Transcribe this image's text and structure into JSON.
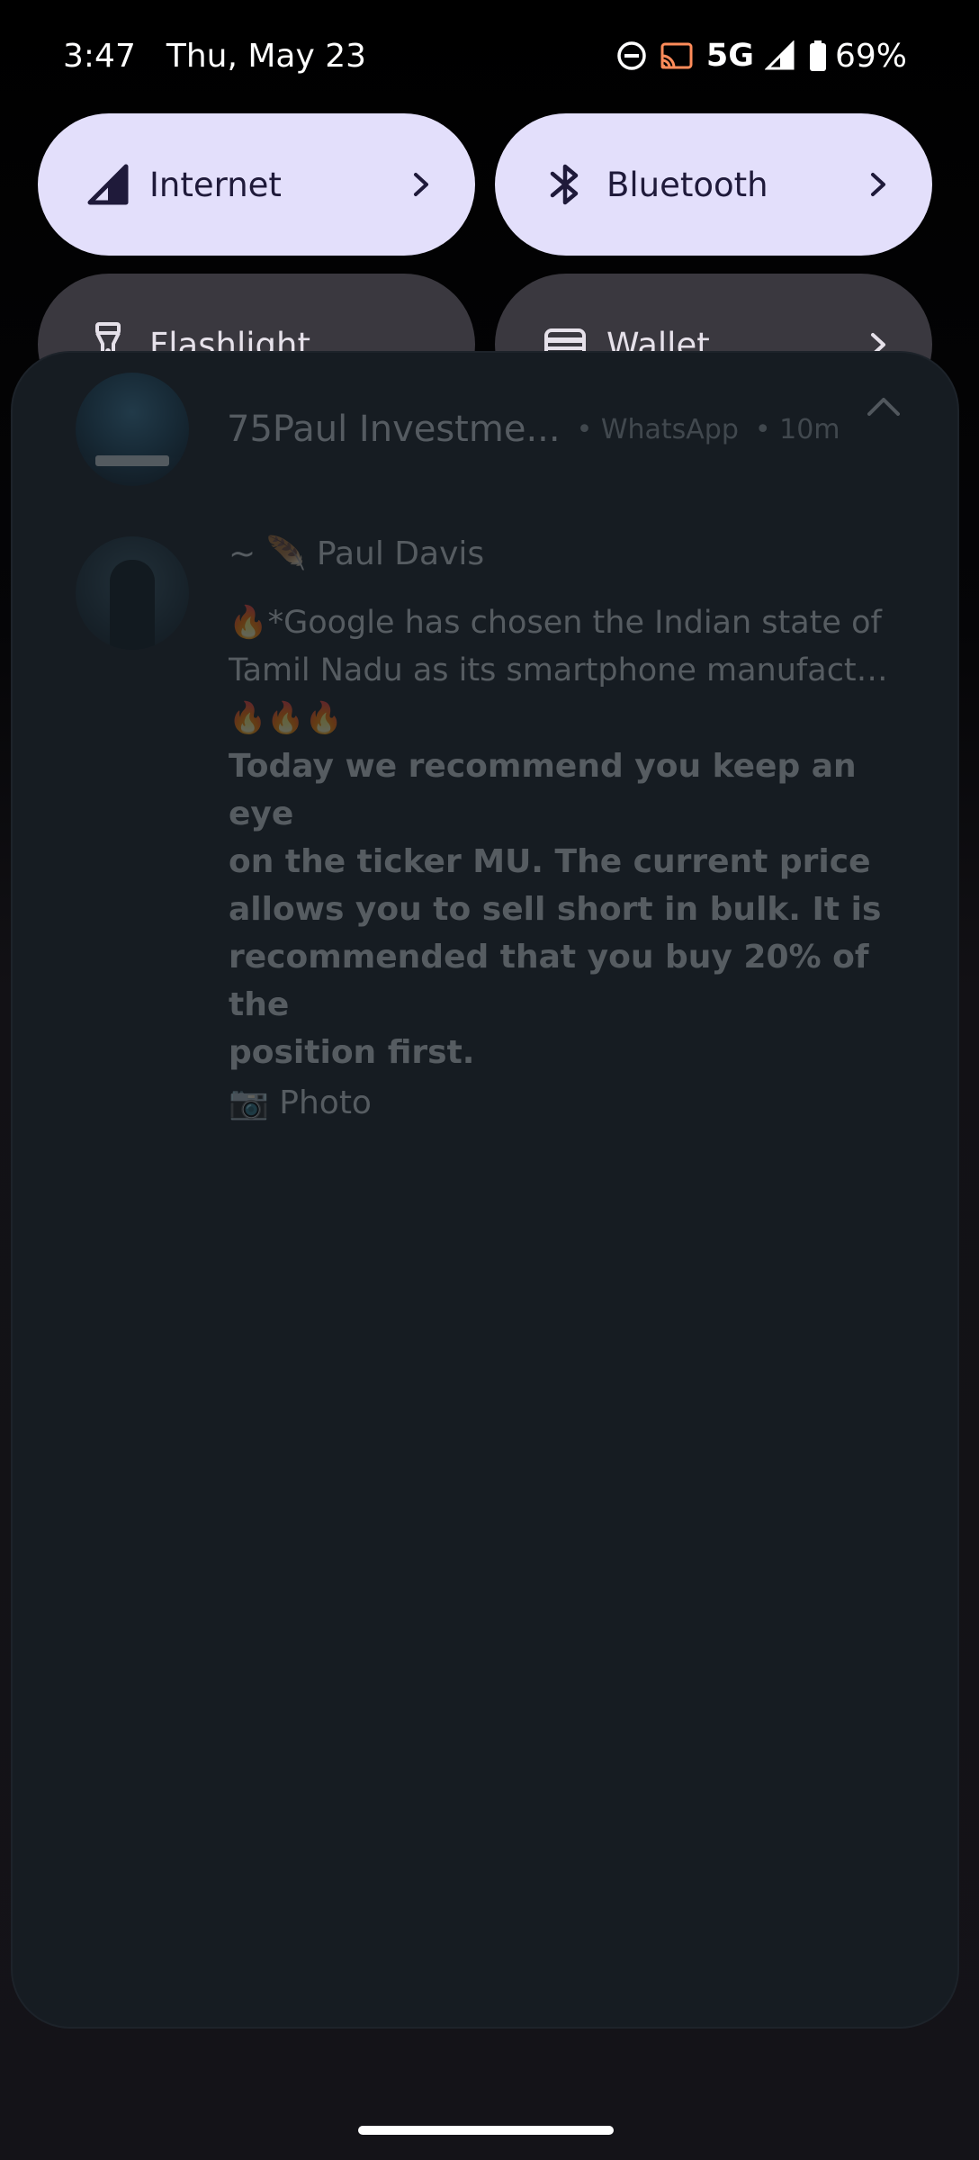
{
  "status_bar": {
    "time": "3:47",
    "date": "Thu, May 23",
    "network": "5G",
    "battery": "69%",
    "icons": [
      "do-not-disturb-icon",
      "cast-icon",
      "signal-icon",
      "battery-icon"
    ]
  },
  "quick_settings": {
    "tiles": [
      {
        "label": "Internet",
        "icon": "signal-triangle-icon",
        "state": "active",
        "has_chevron": true
      },
      {
        "label": "Bluetooth",
        "icon": "bluetooth-icon",
        "state": "active",
        "has_chevron": true
      },
      {
        "label": "Flashlight",
        "icon": "flashlight-icon",
        "state": "inactive",
        "has_chevron": false
      },
      {
        "label": "Wallet",
        "icon": "wallet-icon",
        "state": "inactive",
        "has_chevron": true
      }
    ],
    "colors": {
      "active_bg": "#e3dffb",
      "inactive_bg": "#3a383f"
    }
  },
  "notification": {
    "group_title": "75Paul Investme...",
    "app": "• WhatsApp",
    "time": "• 10m",
    "sender": "~ 🪶 Paul Davis",
    "preview_lines": [
      "🔥*Google has chosen the Indian state of",
      "Tamil Nadu as its smartphone manufacturi..."
    ],
    "emoji_line": "🔥🔥🔥",
    "bold_text": "Today we recommend you keep an eye\non the ticker MU.  The current price\nallows you to sell short in bulk.  It is\nrecommended that you buy 20% of the\nposition first.",
    "attachment": "📷 Photo"
  }
}
